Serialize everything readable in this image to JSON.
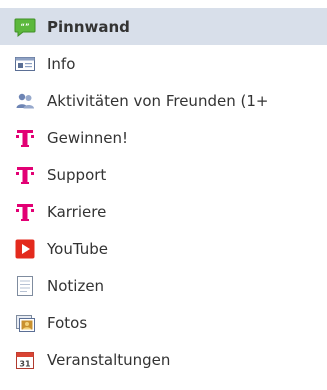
{
  "nav": {
    "items": [
      {
        "label": "Pinnwand",
        "icon": "wall-speech-bubble-icon",
        "selected": true
      },
      {
        "label": "Info",
        "icon": "info-card-icon",
        "selected": false
      },
      {
        "label": "Aktivitäten von Freunden (1+",
        "icon": "friends-icon",
        "selected": false
      },
      {
        "label": "Gewinnen!",
        "icon": "telekom-t-icon",
        "selected": false
      },
      {
        "label": "Support",
        "icon": "telekom-t-icon",
        "selected": false
      },
      {
        "label": "Karriere",
        "icon": "telekom-t-icon",
        "selected": false
      },
      {
        "label": "YouTube",
        "icon": "youtube-play-icon",
        "selected": false
      },
      {
        "label": "Notizen",
        "icon": "notes-icon",
        "selected": false
      },
      {
        "label": "Fotos",
        "icon": "photos-icon",
        "selected": false
      },
      {
        "label": "Veranstaltungen",
        "icon": "calendar-31-icon",
        "selected": false
      }
    ]
  },
  "colors": {
    "selected_bg": "#d8dfea",
    "telekom_magenta": "#e20074",
    "youtube_red": "#e32a1d",
    "wall_green": "#5cb83c"
  }
}
